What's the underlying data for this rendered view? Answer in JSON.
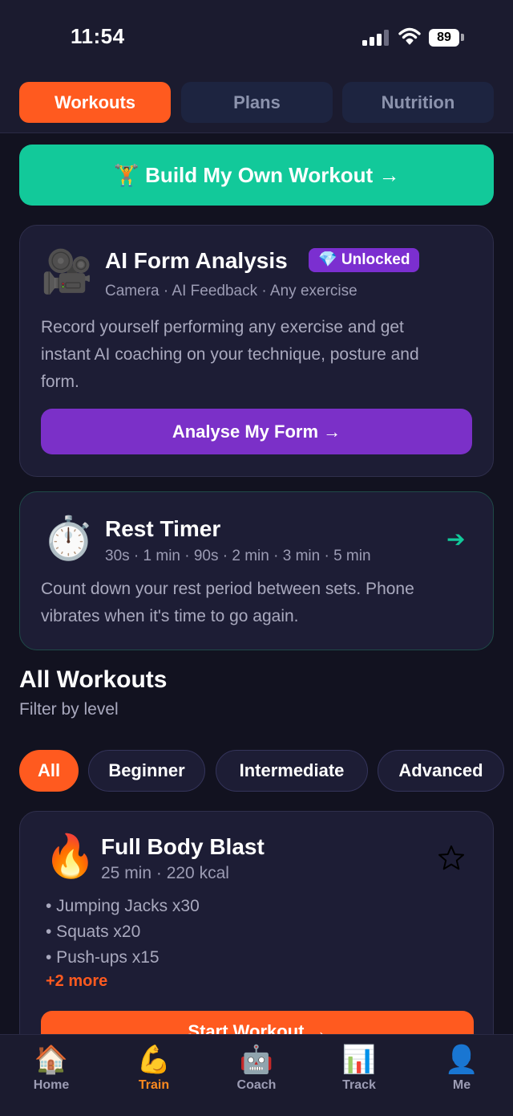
{
  "status": {
    "time": "11:54",
    "battery": "89"
  },
  "tabs": [
    {
      "label": "Workouts",
      "active": true
    },
    {
      "label": "Plans",
      "active": false
    },
    {
      "label": "Nutrition",
      "active": false
    }
  ],
  "build_button": {
    "icon": "🏋️",
    "label": "Build My Own Workout →"
  },
  "form_card": {
    "icon": "🎥",
    "title": "AI Form Analysis",
    "badge": "💎 Unlocked",
    "subtitle": "Camera · AI Feedback · Any exercise",
    "desc_lines": [
      "Record yourself performing any exercise and get",
      "instant AI coaching on your technique, posture and",
      "form."
    ],
    "button": "Analyse My Form →"
  },
  "timer_card": {
    "icon": "⏱️",
    "title": "Rest Timer",
    "subtitle": "30s · 1 min · 90s · 2 min · 3 min · 5 min",
    "arrow": "➔",
    "desc_lines": [
      "Count down your rest period between sets. Phone",
      "vibrates when it's time to go again."
    ]
  },
  "section": {
    "title": "All Workouts",
    "subtitle": "Filter by level"
  },
  "filters": [
    {
      "label": "All",
      "active": true
    },
    {
      "label": "Beginner",
      "active": false
    },
    {
      "label": "Intermediate",
      "active": false
    },
    {
      "label": "Advanced",
      "active": false
    }
  ],
  "workout_card": {
    "icon": "🔥",
    "title": "Full Body Blast",
    "meta": "25 min · 220 kcal",
    "exercises": [
      "• Jumping Jacks x30",
      "• Squats x20",
      "• Push-ups x15"
    ],
    "more": "+2 more",
    "button": "Start Workout →"
  },
  "nav": [
    {
      "icon": "🏠",
      "label": "Home",
      "active": false
    },
    {
      "icon": "💪",
      "label": "Train",
      "active": true
    },
    {
      "icon": "🤖",
      "label": "Coach",
      "active": false
    },
    {
      "icon": "📊",
      "label": "Track",
      "active": false
    },
    {
      "icon": "👤",
      "label": "Me",
      "active": false
    }
  ]
}
